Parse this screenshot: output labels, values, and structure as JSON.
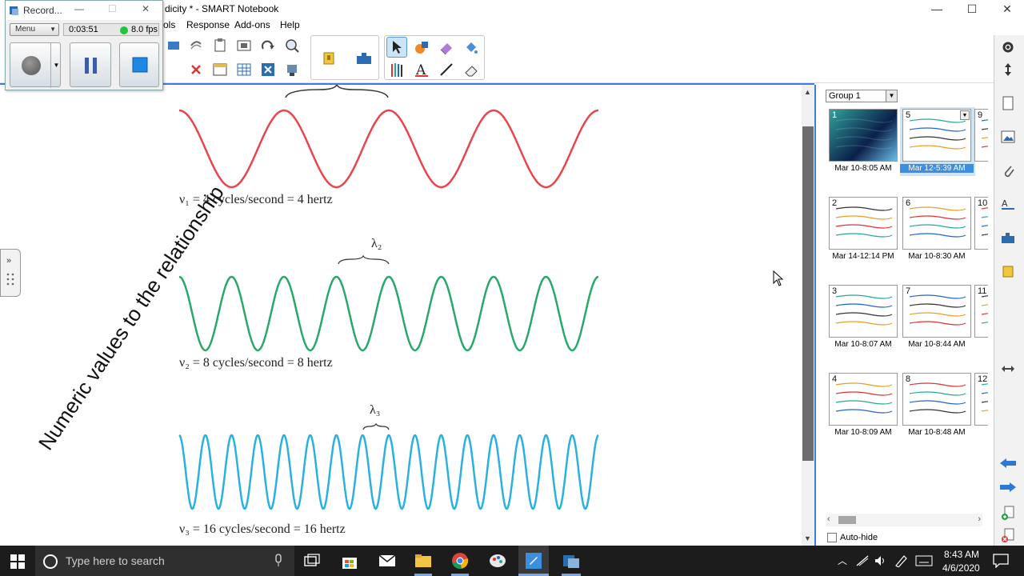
{
  "window": {
    "title": "dicity * - SMART Notebook",
    "minimize_glyph": "—",
    "maximize_glyph": "☐",
    "close_glyph": "✕"
  },
  "menu": {
    "items": [
      "ols",
      "Response",
      "Add-ons",
      "Help"
    ]
  },
  "recorder": {
    "title": "Record...",
    "menu_label": "Menu",
    "timer": "0:03:51",
    "fps": "8.0 fps"
  },
  "canvas": {
    "rotated_text": "Numeric values to the relationship",
    "waves": [
      {
        "color": "#e8454d",
        "cycles": 4,
        "equation": "ν₁ = 4 cycles/second = 4 hertz",
        "lambda_label": ""
      },
      {
        "color": "#2aa86a",
        "cycles": 8,
        "equation": "ν₂ = 8 cycles/second = 8 hertz",
        "lambda_label": "λ₂"
      },
      {
        "color": "#2bb1e0",
        "cycles": 16,
        "equation": "ν₃ = 16 cycles/second = 16 hertz",
        "lambda_label": "λ₃"
      }
    ]
  },
  "sidepanel": {
    "group_select": "Group 1",
    "auto_hide_label": "Auto-hide",
    "thumbnails": [
      {
        "num": "1",
        "caption": "Mar 10-8:05 AM",
        "selected": false
      },
      {
        "num": "5",
        "caption": "Mar 12-5:39 AM",
        "selected": true
      },
      {
        "num": "9",
        "caption": "Ma",
        "selected": false
      },
      {
        "num": "2",
        "caption": "Mar 14-12:14 PM",
        "selected": false
      },
      {
        "num": "6",
        "caption": "Mar 10-8:30 AM",
        "selected": false
      },
      {
        "num": "10",
        "caption": "Ma",
        "selected": false
      },
      {
        "num": "3",
        "caption": "Mar 10-8:07 AM",
        "selected": false
      },
      {
        "num": "7",
        "caption": "Mar 10-8:44 AM",
        "selected": false
      },
      {
        "num": "11",
        "caption": "Ma",
        "selected": false
      },
      {
        "num": "4",
        "caption": "Mar 10-8:09 AM",
        "selected": false
      },
      {
        "num": "8",
        "caption": "Mar 10-8:48 AM",
        "selected": false
      },
      {
        "num": "12",
        "caption": "Ma",
        "selected": false
      }
    ]
  },
  "taskbar": {
    "search_placeholder": "Type here to search",
    "time": "8:43 AM",
    "date": "4/6/2020"
  },
  "colors": {
    "accent": "#3c7fd8",
    "selected_thumb": "#cce4f7",
    "taskbar": "#1c1c1c"
  }
}
